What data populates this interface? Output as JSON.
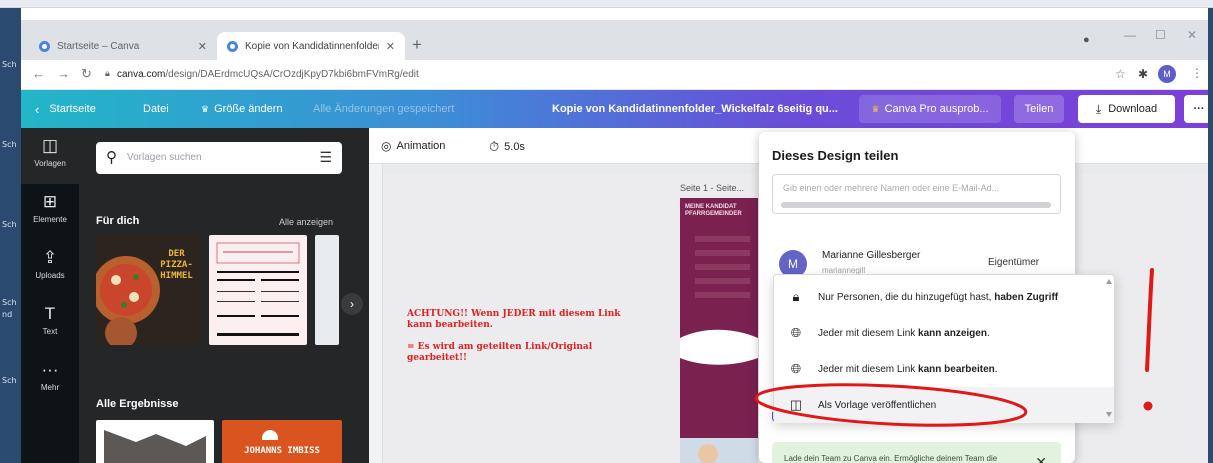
{
  "desktop": {
    "side_labels": [
      "Sch",
      "Sch",
      "Sch",
      "Sch",
      "nd",
      "Sch"
    ]
  },
  "browser": {
    "tabs": [
      {
        "title": "Startseite – Canva",
        "active": false
      },
      {
        "title": "Kopie von Kandidatinnenfolder_",
        "active": true
      }
    ],
    "new_tab": "+",
    "url_host": "canva.com",
    "url_path": "/design/DAErdmcUQsA/CrOzdjKpyD7kbi6bmFVmRg/edit",
    "profile_initial": "M"
  },
  "canva_header": {
    "back_label": "Startseite",
    "file_label": "Datei",
    "resize_label": "Größe ändern",
    "saved_status": "Alle Änderungen gespeichert",
    "doc_title": "Kopie von Kandidatinnenfolder_Wickelfalz 6seitig qu...",
    "pro_label": "Canva Pro ausprob...",
    "share_label": "Teilen",
    "download_label": "Download",
    "more_label": "···"
  },
  "rail": [
    {
      "label": "Vorlagen",
      "icon": "template-icon"
    },
    {
      "label": "Elemente",
      "icon": "elements-icon"
    },
    {
      "label": "Uploads",
      "icon": "upload-icon"
    },
    {
      "label": "Text",
      "icon": "text-icon"
    },
    {
      "label": "Mehr",
      "icon": "more-icon"
    }
  ],
  "panel": {
    "search_placeholder": "Vorlagen suchen",
    "section_for_you": "Für dich",
    "see_all": "Alle anzeigen",
    "section_all_results": "Alle Ergebnisse",
    "pizza_title": "DER PIZZA-HIMMEL",
    "johanns_title": "JOHANNS IMBISS"
  },
  "toolbar": {
    "animation_label": "Animation",
    "duration_label": "5.0s"
  },
  "canvas": {
    "note_line1": "ACHTUNG!! Wenn JEDER mit diesem Link kann bearbeiten.",
    "note_line2": "= Es wird am geteilten Link/Original gearbeitet!!",
    "page_label": "Seite 1 - Seite...",
    "doc_heading": "MEINE KANDIDAT PFARRGEMEINDER"
  },
  "share_dialog": {
    "title": "Dieses Design teilen",
    "input_placeholder": "Gib einen oder mehrere Namen oder eine E-Mail-Ad...",
    "owner_initial": "M",
    "owner_name": "Marianne Gillesberger",
    "owner_email": "mariannegill",
    "owner_role": "Eigentümer",
    "team_text": "Lade dein Team zu Canva ein. Ermögliche deinem Team die Zusammenarbeit an einem Ort und in"
  },
  "access_dropdown": {
    "items": [
      {
        "pre": "Nur Personen, die du hinzugefügt hast, ",
        "bold": "haben Zugriff",
        "icon": "lock-icon"
      },
      {
        "pre": "Jeder mit diesem Link ",
        "bold": "kann anzeigen",
        "post": ".",
        "icon": "globe-icon"
      },
      {
        "pre": "Jeder mit diesem Link ",
        "bold": "kann bearbeiten",
        "post": ".",
        "icon": "globe-icon"
      },
      {
        "pre": "Als Vorlage veröffentlichen",
        "bold": "",
        "icon": "template-icon"
      }
    ]
  },
  "colors": {
    "annotation_red": "#e01818",
    "header_gradient_start": "#22b6c8",
    "header_gradient_end": "#7d3fd9",
    "rail_bg": "#0e1318",
    "panel_bg": "#252627",
    "doc_page": "#7b2150"
  }
}
